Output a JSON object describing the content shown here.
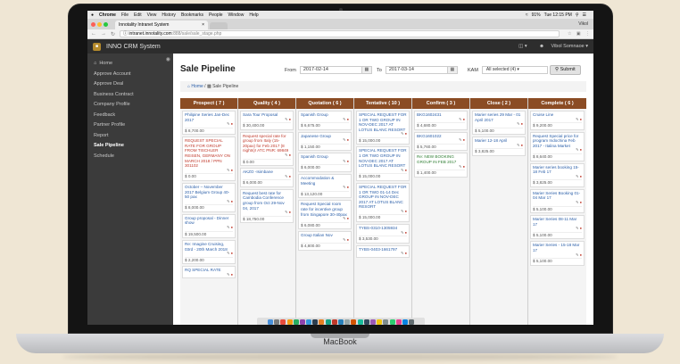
{
  "device_label": "MacBook",
  "menubar": {
    "app": "Chrome",
    "items": [
      "File",
      "Edit",
      "View",
      "History",
      "Bookmarks",
      "People",
      "Window",
      "Help"
    ],
    "battery": "91%",
    "clock": "Tue 12:15 PM"
  },
  "browser": {
    "tab_title": "Innotality Intranet System",
    "tab_close": "×",
    "profile": "Vikol",
    "url_host": "intranet.innotality.com",
    "url_path": ":888/sale/sale_stage.php"
  },
  "app": {
    "brand": "INNO CRM System",
    "user": "Vibol Somnaoe",
    "sidebar": [
      {
        "label": "Home",
        "active": false
      },
      {
        "label": "Approve Account",
        "active": false
      },
      {
        "label": "Approve Deal",
        "active": false
      },
      {
        "label": "Business Contract",
        "active": false
      },
      {
        "label": "Company Profile",
        "active": false
      },
      {
        "label": "Feedback",
        "active": false
      },
      {
        "label": "Partner Profile",
        "active": false
      },
      {
        "label": "Report",
        "active": false
      },
      {
        "label": "Sale Pipeline",
        "active": true
      },
      {
        "label": "Schedule",
        "active": false
      }
    ]
  },
  "page": {
    "title": "Sale Pipeline",
    "from_label": "From",
    "from_value": "2017-02-14",
    "to_label": "To",
    "to_value": "2017-03-14",
    "kam_label": "KAM",
    "kam_value": "All selected (4) ▾",
    "submit_label": "Submit",
    "breadcrumb_home": "Home",
    "breadcrumb_current": "Sale Pipeline"
  },
  "columns": [
    {
      "title": "Prospect ( 7 )",
      "cards": [
        {
          "text": "Philipine Series Jan-Dec 2017",
          "amount": "$ 8,700.00",
          "color": "blue"
        },
        {
          "text": "REQUEST SPECIAL RATE FOR GROUP FROM TISCHLER REISEN, GERMANY ON MARCH 2018 / PPN 301102",
          "amount": "$ 0.00",
          "color": "red"
        },
        {
          "text": "October – November 2017 Belgium Group 40-50 pax",
          "amount": "$ 8,000.00",
          "color": "blue"
        },
        {
          "text": "Group proposal - Dinner show",
          "amount": "$ 19,500.00",
          "color": "blue"
        },
        {
          "text": "Re: Imagine Cruising, 03rd - 20th March 2018",
          "amount": "$ 2,200.00",
          "color": "blue"
        },
        {
          "text": "RQ SPECIAL RATE",
          "amount": "",
          "color": "blue"
        }
      ]
    },
    {
      "title": "Quality ( 4 )",
      "cards": [
        {
          "text": "Sara Tour Proposal",
          "amount": "$ 30,400.00",
          "color": "blue"
        },
        {
          "text": "Request special rate for group from Italy (15-20pax) for Feb 2017 (8 nights)! ATC PNR: 69849",
          "amount": "$ 0.00",
          "color": "red"
        },
        {
          "text": "AKZO -Isimbane",
          "amount": "$ 6,000.00",
          "color": "blue"
        },
        {
          "text": "Request best rate for Cambodia Conference group from Oct 29-Nov 04, 2017",
          "amount": "$ 18,750.00",
          "color": "blue"
        }
      ]
    },
    {
      "title": "Quotation ( 6 )",
      "cards": [
        {
          "text": "Spanish Group",
          "amount": "$ 6,675.00",
          "color": "blue"
        },
        {
          "text": "Japanese Group",
          "amount": "$ 1,150.00",
          "color": "blue"
        },
        {
          "text": "Spanish Group",
          "amount": "$ 6,000.00",
          "color": "blue"
        },
        {
          "text": "Accommodation & Meeting",
          "amount": "$ 13,120.00",
          "color": "blue"
        },
        {
          "text": "Request Special room rate for incentive group from Singapore 30-40pax",
          "amount": "$ 6,080.00",
          "color": "blue"
        },
        {
          "text": "Group Italian Nov",
          "amount": "$ 4,800.00",
          "color": "blue"
        }
      ]
    },
    {
      "title": "Tentative ( 10 )",
      "cards": [
        {
          "text": "SPECIAL REQUEST FOR 1 OR TWO GROUP IN NOV-DEC 2017 AT LOTUS BLANC RESORT",
          "amount": "$ 15,000.00",
          "color": "blue"
        },
        {
          "text": "SPECIAL REQUEST FOR 1 OR TWO GROUP IN NOV-DEC 2017 AT LOTUS BLANC RESORT",
          "amount": "$ 15,000.00",
          "color": "blue"
        },
        {
          "text": "SPECIAL REQUEST FOR 1 OR TWO 01-14 Dec GROUP IN NOV-DEC 2017 AT LOTUS BLANC RESORT",
          "amount": "$ 15,000.00",
          "color": "blue"
        },
        {
          "text": "TYBS-0310-1305934",
          "amount": "$ 3,530.00",
          "color": "blue"
        },
        {
          "text": "TYBS-0403-1661797",
          "amount": "",
          "color": "blue"
        }
      ]
    },
    {
      "title": "Confirm ( 3 )",
      "cards": [
        {
          "text": "BKG1602431",
          "amount": "$ 4,680.00",
          "color": "blue"
        },
        {
          "text": "BKG1601022",
          "amount": "$ 5,760.00",
          "color": "blue"
        },
        {
          "text": "Re: NEW BOOKING GROUP IN FEB 2017",
          "amount": "$ 1,400.00",
          "color": "green"
        }
      ]
    },
    {
      "title": "Close ( 2 )",
      "cards": [
        {
          "text": "Marier series 29 Mar - 01 April 2017",
          "amount": "$ 5,100.00",
          "color": "blue"
        },
        {
          "text": "Marier 12-18 April",
          "amount": "$ 3,825.00",
          "color": "blue"
        }
      ]
    },
    {
      "title": "Complete ( 6 )",
      "cards": [
        {
          "text": "Cruise Line",
          "amount": "$ 9,200.00",
          "color": "blue"
        },
        {
          "text": "Request Special price for program Indochina Feb 2017 - Italina Market",
          "amount": "$ 8,640.00",
          "color": "blue"
        },
        {
          "text": "Marier series booking 15-18 Feb 17",
          "amount": "$ 3,825.00",
          "color": "blue"
        },
        {
          "text": "Marier Series Booking 01-04 Mar 17",
          "amount": "$ 5,100.00",
          "color": "blue"
        },
        {
          "text": "Marier Series 08-11 Mar 17",
          "amount": "$ 5,100.00",
          "color": "blue"
        },
        {
          "text": "Marier Series - 15-18 Mar 17",
          "amount": "$ 5,100.00",
          "color": "blue"
        }
      ]
    }
  ],
  "colors": {
    "column_header": "#8b4c24",
    "sidebar_bg": "#3b3b3b",
    "header_bg": "#2d2d2d",
    "link_blue": "#2a5ea8",
    "alert_red": "#c0392b"
  }
}
